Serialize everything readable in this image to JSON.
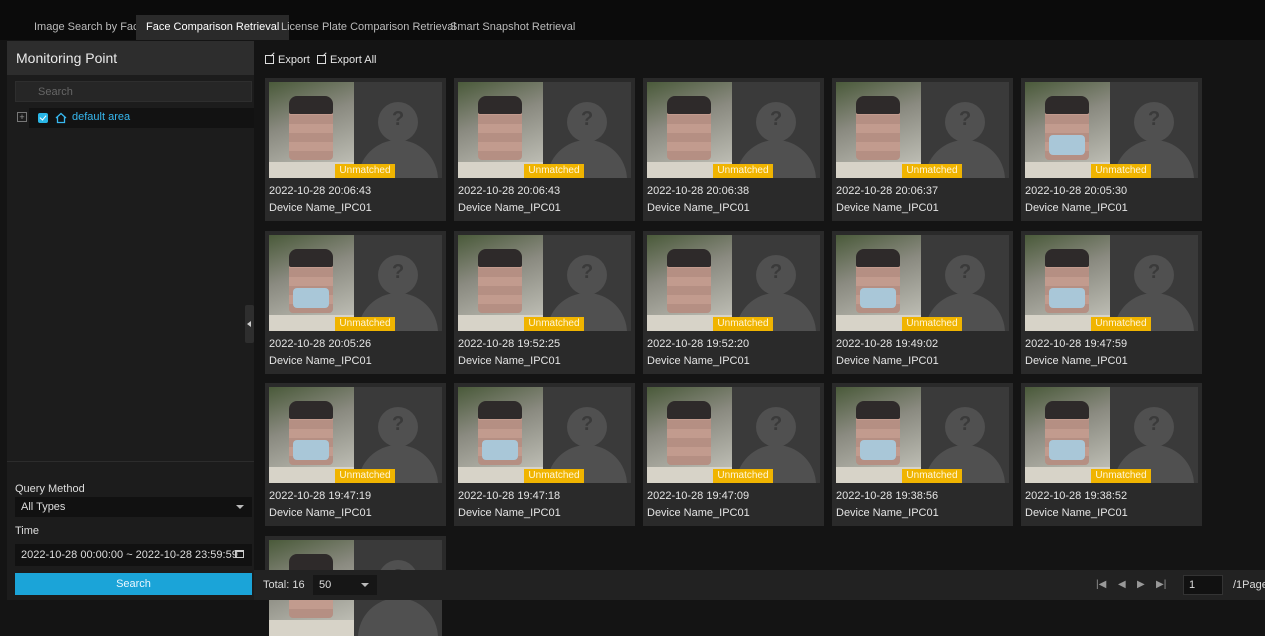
{
  "tabs": [
    {
      "label": "Image Search by Face"
    },
    {
      "label": "Face Comparison Retrieval"
    },
    {
      "label": "License Plate Comparison Retrieval"
    },
    {
      "label": "Smart Snapshot Retrieval"
    }
  ],
  "active_tab": 1,
  "sidebar": {
    "title": "Monitoring Point",
    "search_placeholder": "Search",
    "tree": [
      {
        "label": "default area",
        "checked": true
      }
    ],
    "query_method_label": "Query Method",
    "query_method_value": "All Types",
    "time_label": "Time",
    "time_value": "2022-10-28 00:00:00 ~ 2022-10-28 23:59:59",
    "search_button": "Search"
  },
  "toolbar": {
    "export_label": "Export",
    "export_all_label": "Export All"
  },
  "results": [
    {
      "time": "2022-10-28 20:06:43",
      "device": "Device Name_IPC01",
      "status": "Unmatched",
      "mask": false
    },
    {
      "time": "2022-10-28 20:06:43",
      "device": "Device Name_IPC01",
      "status": "Unmatched",
      "mask": false
    },
    {
      "time": "2022-10-28 20:06:38",
      "device": "Device Name_IPC01",
      "status": "Unmatched",
      "mask": false
    },
    {
      "time": "2022-10-28 20:06:37",
      "device": "Device Name_IPC01",
      "status": "Unmatched",
      "mask": false
    },
    {
      "time": "2022-10-28 20:05:30",
      "device": "Device Name_IPC01",
      "status": "Unmatched",
      "mask": true
    },
    {
      "time": "2022-10-28 20:05:26",
      "device": "Device Name_IPC01",
      "status": "Unmatched",
      "mask": true
    },
    {
      "time": "2022-10-28 19:52:25",
      "device": "Device Name_IPC01",
      "status": "Unmatched",
      "mask": false
    },
    {
      "time": "2022-10-28 19:52:20",
      "device": "Device Name_IPC01",
      "status": "Unmatched",
      "mask": false
    },
    {
      "time": "2022-10-28 19:49:02",
      "device": "Device Name_IPC01",
      "status": "Unmatched",
      "mask": true
    },
    {
      "time": "2022-10-28 19:47:59",
      "device": "Device Name_IPC01",
      "status": "Unmatched",
      "mask": true
    },
    {
      "time": "2022-10-28 19:47:19",
      "device": "Device Name_IPC01",
      "status": "Unmatched",
      "mask": true
    },
    {
      "time": "2022-10-28 19:47:18",
      "device": "Device Name_IPC01",
      "status": "Unmatched",
      "mask": true
    },
    {
      "time": "2022-10-28 19:47:09",
      "device": "Device Name_IPC01",
      "status": "Unmatched",
      "mask": false
    },
    {
      "time": "2022-10-28 19:38:56",
      "device": "Device Name_IPC01",
      "status": "Unmatched",
      "mask": true
    },
    {
      "time": "2022-10-28 19:38:52",
      "device": "Device Name_IPC01",
      "status": "Unmatched",
      "mask": true
    },
    {
      "time": "",
      "device": "",
      "status": "",
      "mask": false
    }
  ],
  "pager": {
    "total_label": "Total: 16",
    "page_size": "50",
    "first_icon": "first-page-icon",
    "prev_icon": "prev-page-icon",
    "next_icon": "next-page-icon",
    "last_icon": "last-page-icon",
    "current_page": "1",
    "page_suffix": "/1Page"
  },
  "colors": {
    "accent": "#1ba4d8",
    "badge": "#f0b400",
    "tree_label": "#37b8ef"
  }
}
